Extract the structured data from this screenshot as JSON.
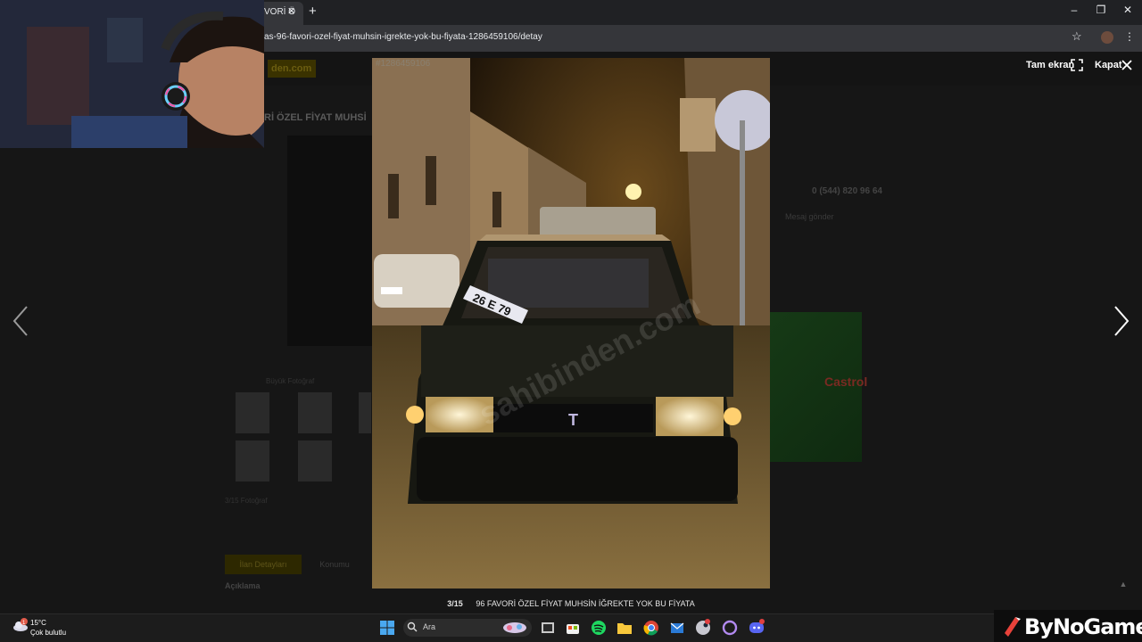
{
  "browser": {
    "tab_title": "VORİ Ö",
    "url": "as-96-favori-ozel-fiyat-muhsin-igrekte-yok-bu-fiyata-1286459106/detay"
  },
  "page": {
    "logo": "den.com",
    "title": "Rİ ÖZEL FİYAT MUHSİ",
    "phone": "0 (544) 820 96 64",
    "message": "Mesaj gönder",
    "photos_link": "Büyük Fotoğraf",
    "photo_count": "3/15 Fotoğraf",
    "tab_details": "İlan Detayları",
    "tab_location": "Konumu",
    "description": "Açıklama",
    "ad_brand": "Castrol"
  },
  "lightbox": {
    "listing_id": "#1286459106",
    "fullscreen_label": "Tam ekran",
    "close_label": "Kapat",
    "counter": "3/15",
    "caption": "96 FAVORİ ÖZEL FİYAT MUHSİN İĞREKTE YOK BU FİYATA",
    "plate_text": "26 E 79",
    "watermark": "sahibinden.com"
  },
  "taskbar": {
    "temperature": "15°C",
    "condition": "Çok bulutlu",
    "search_label": "Ara",
    "weather_badge": "1"
  },
  "overlay": {
    "brand": "ByNoGame"
  }
}
